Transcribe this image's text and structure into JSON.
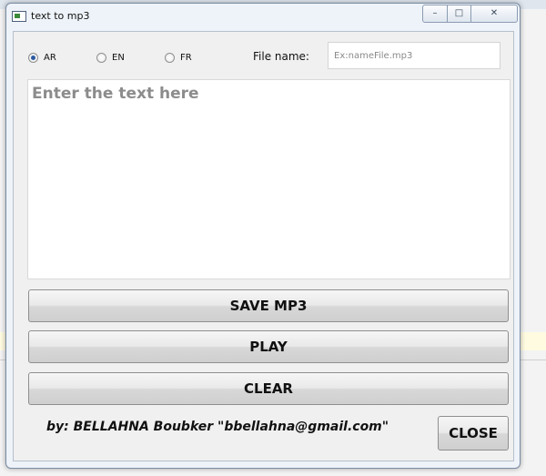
{
  "window": {
    "title": "text to mp3"
  },
  "titlebar": {
    "min_glyph": "–",
    "max_glyph": "□",
    "close_glyph": "✕"
  },
  "language": {
    "options": [
      {
        "label": "AR",
        "checked": true
      },
      {
        "label": "EN",
        "checked": false
      },
      {
        "label": "FR",
        "checked": false
      }
    ]
  },
  "file": {
    "label": "File name:",
    "placeholder": "Ex:nameFile.mp3",
    "value": ""
  },
  "text_input": {
    "placeholder": "Enter the text here",
    "value": ""
  },
  "buttons": {
    "save": "SAVE MP3",
    "play": "PLAY",
    "clear": "CLEAR",
    "close": "CLOSE"
  },
  "footer": {
    "credit": "by: BELLAHNA Boubker \"bbellahna@gmail.com\""
  },
  "colors": {
    "radio_checked": "#2c5aa0",
    "window_border": "#7a8ca4"
  }
}
